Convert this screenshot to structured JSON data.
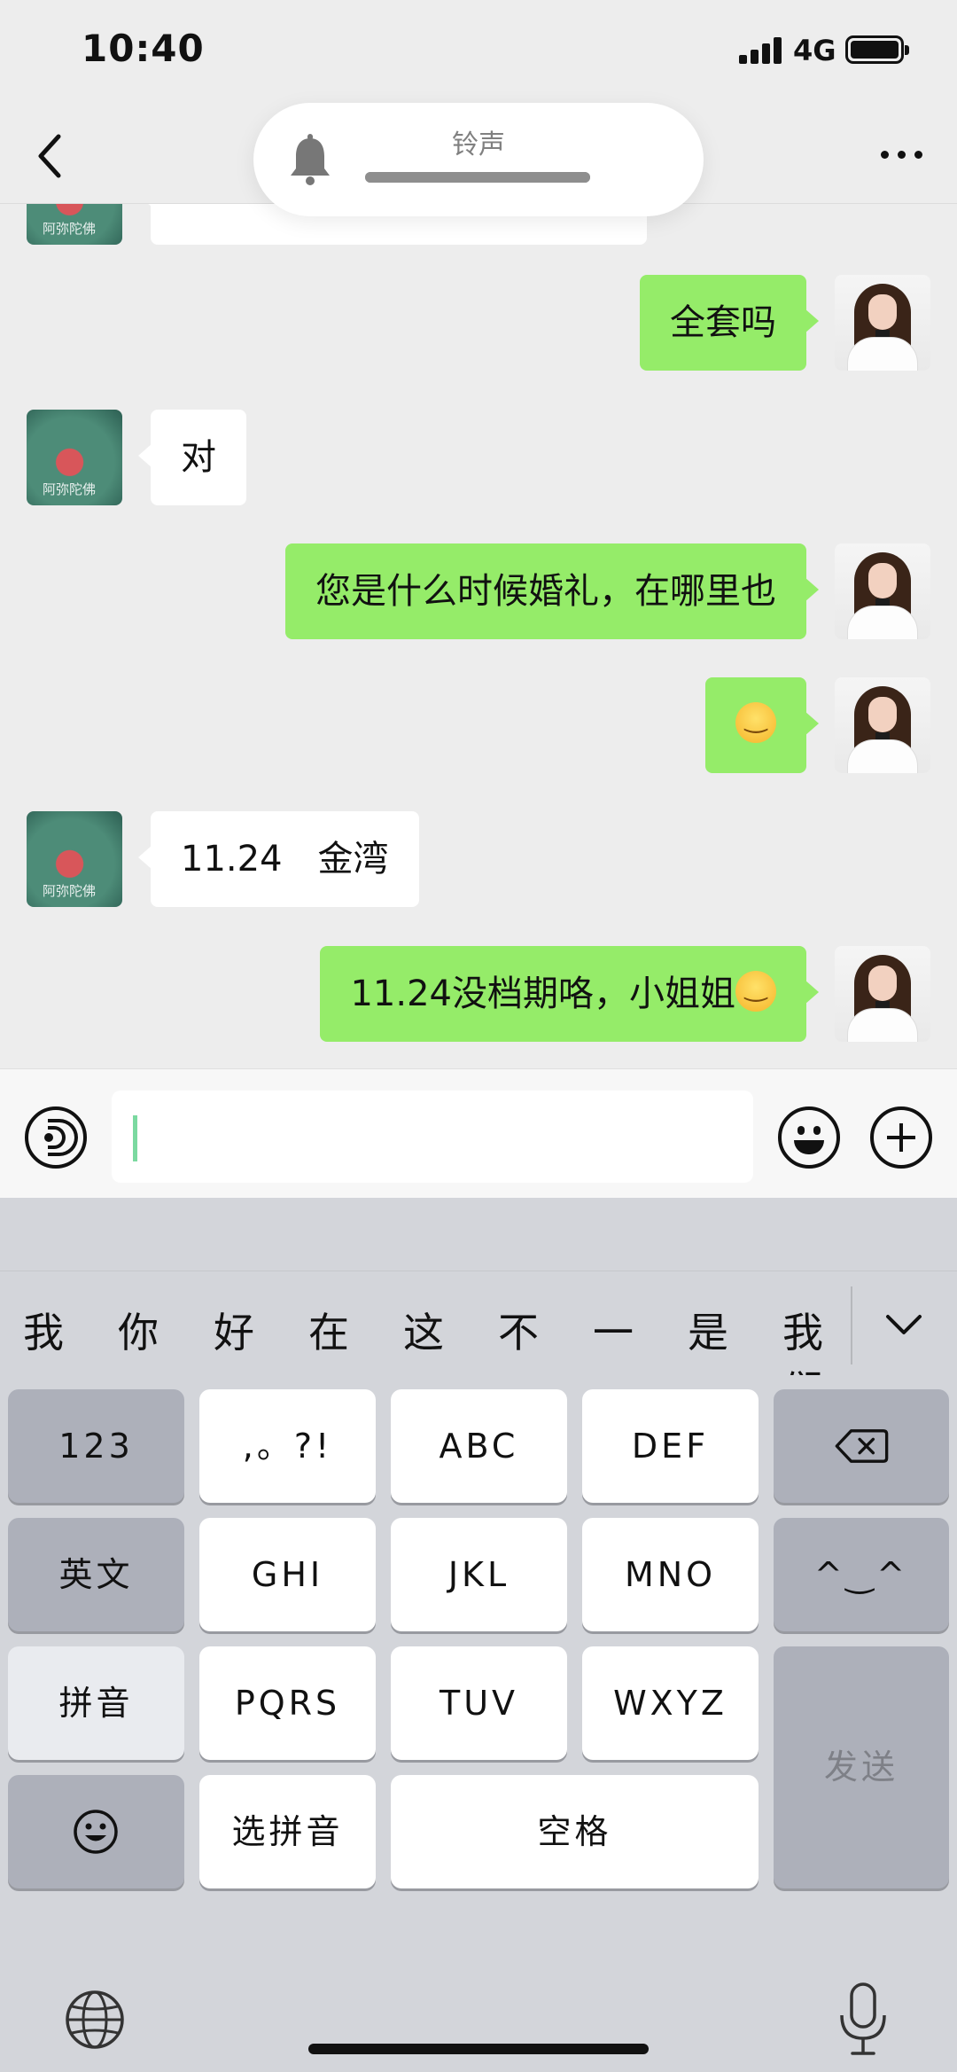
{
  "status_bar": {
    "time": "10:40",
    "network": "4G"
  },
  "ringtone": {
    "label": "铃声",
    "level": 1.0
  },
  "messages": [
    {
      "side": "left",
      "text": ""
    },
    {
      "side": "right",
      "text": "全套吗"
    },
    {
      "side": "left",
      "text": "对"
    },
    {
      "side": "right",
      "text": "您是什么时候婚礼，在哪里也"
    },
    {
      "side": "right",
      "text": "",
      "emoji": "smiling-face"
    },
    {
      "side": "left",
      "text": "11.24　金湾"
    },
    {
      "side": "right",
      "text": "11.24没档期咯，小姐姐",
      "emoji": "smiling-face"
    }
  ],
  "avatar_watermark": "阿弥陀佛",
  "input": {
    "value": "",
    "placeholder": ""
  },
  "candidates": [
    "我",
    "你",
    "好",
    "在",
    "这",
    "不",
    "一",
    "是",
    "我们"
  ],
  "keyboard": {
    "rows": [
      [
        "123",
        ",。?!",
        "ABC",
        "DEF",
        "⌫"
      ],
      [
        "英文",
        "GHI",
        "JKL",
        "MNO",
        "^^"
      ],
      [
        "拼音",
        "PQRS",
        "TUV",
        "WXYZ"
      ],
      [
        "☺",
        "选拼音",
        "空格"
      ]
    ],
    "key_123": "123",
    "key_punct": ",。?!",
    "key_abc": "ABC",
    "key_def": "DEF",
    "key_english": "英文",
    "key_ghi": "GHI",
    "key_jkl": "JKL",
    "key_mno": "MNO",
    "key_face": "^‿^",
    "key_pinyin": "拼音",
    "key_pqrs": "PQRS",
    "key_tuv": "TUV",
    "key_wxyz": "WXYZ",
    "key_select_pinyin": "选拼音",
    "key_space": "空格",
    "key_send": "发送"
  },
  "colors": {
    "outgoing_bubble": "#95ec69",
    "incoming_bubble": "#ffffff",
    "background": "#ededed"
  }
}
